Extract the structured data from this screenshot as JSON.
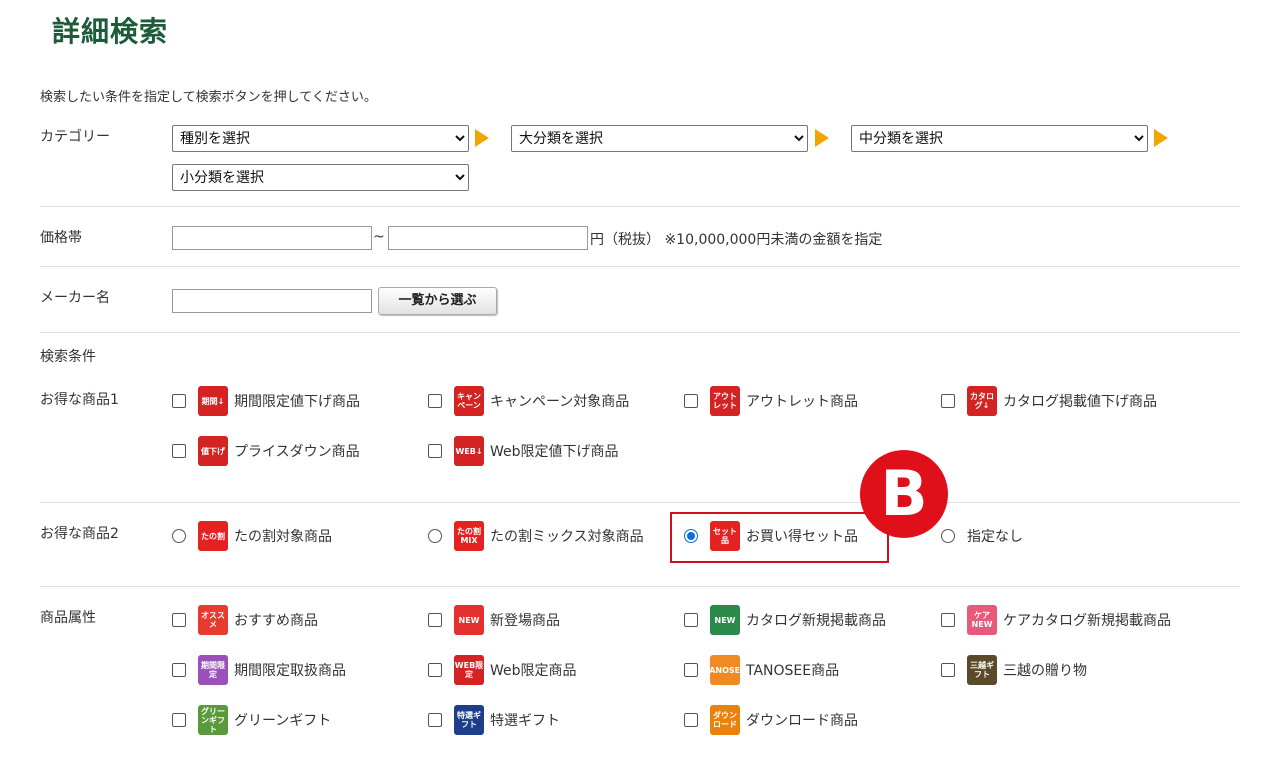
{
  "title": "詳細検索",
  "intro": "検索したい条件を指定して検索ボタンを押してください。",
  "category": {
    "label": "カテゴリー",
    "selects": [
      "種別を選択",
      "大分類を選択",
      "中分類を選択",
      "小分類を選択"
    ]
  },
  "price": {
    "label": "価格帯",
    "tilde": "~",
    "note": "円（税抜） ※10,000,000円未満の金額を指定"
  },
  "maker": {
    "label": "メーカー名",
    "button": "一覧から選ぶ"
  },
  "conditions_label": "検索条件",
  "deals1": {
    "label": "お得な商品1",
    "options": [
      {
        "label": "期間限定値下げ商品",
        "badge": "期間↓",
        "color": "#d42323"
      },
      {
        "label": "キャンペーン対象商品",
        "badge": "キャンペーン",
        "color": "#d42323"
      },
      {
        "label": "アウトレット商品",
        "badge": "アウトレット",
        "color": "#d42323"
      },
      {
        "label": "カタログ掲載値下げ商品",
        "badge": "カタログ↓",
        "color": "#d42323"
      },
      {
        "label": "プライスダウン商品",
        "badge": "値下げ",
        "color": "#d42323"
      },
      {
        "label": "Web限定値下げ商品",
        "badge": "WEB↓",
        "color": "#d42323"
      }
    ]
  },
  "deals2": {
    "label": "お得な商品2",
    "options": [
      {
        "label": "たの割対象商品",
        "badge": "たの割",
        "color": "#e52222"
      },
      {
        "label": "たの割ミックス対象商品",
        "badge": "たの割MIX",
        "color": "#e52222"
      },
      {
        "label": "お買い得セット品",
        "badge": "セット品",
        "color": "#e52222",
        "checked": true
      },
      {
        "label": "指定なし"
      }
    ],
    "highlight_mark": "B"
  },
  "attributes": {
    "label": "商品属性",
    "options": [
      {
        "label": "おすすめ商品",
        "badge": "オススメ",
        "color": "#e63b2e"
      },
      {
        "label": "新登場商品",
        "badge": "NEW",
        "color": "#e53030"
      },
      {
        "label": "カタログ新規掲載商品",
        "badge": "NEW",
        "color": "#2b8a4a"
      },
      {
        "label": "ケアカタログ新規掲載商品",
        "badge": "ケアNEW",
        "color": "#e85a7a"
      },
      {
        "label": "期間限定取扱商品",
        "badge": "期間限定",
        "color": "#9b4fb8"
      },
      {
        "label": "Web限定商品",
        "badge": "WEB限定",
        "color": "#d42323"
      },
      {
        "label": "TANOSEE商品",
        "badge": "TANOSEE",
        "color": "#f08a24"
      },
      {
        "label": "三越の贈り物",
        "badge": "三越ギフト",
        "color": "#5a4a2a"
      },
      {
        "label": "グリーンギフト",
        "badge": "グリーンギフト",
        "color": "#5b9a3b"
      },
      {
        "label": "特選ギフト",
        "badge": "特選ギフト",
        "color": "#1e3d8a"
      },
      {
        "label": "ダウンロード商品",
        "badge": "ダウンロード",
        "color": "#e8820c"
      }
    ]
  }
}
